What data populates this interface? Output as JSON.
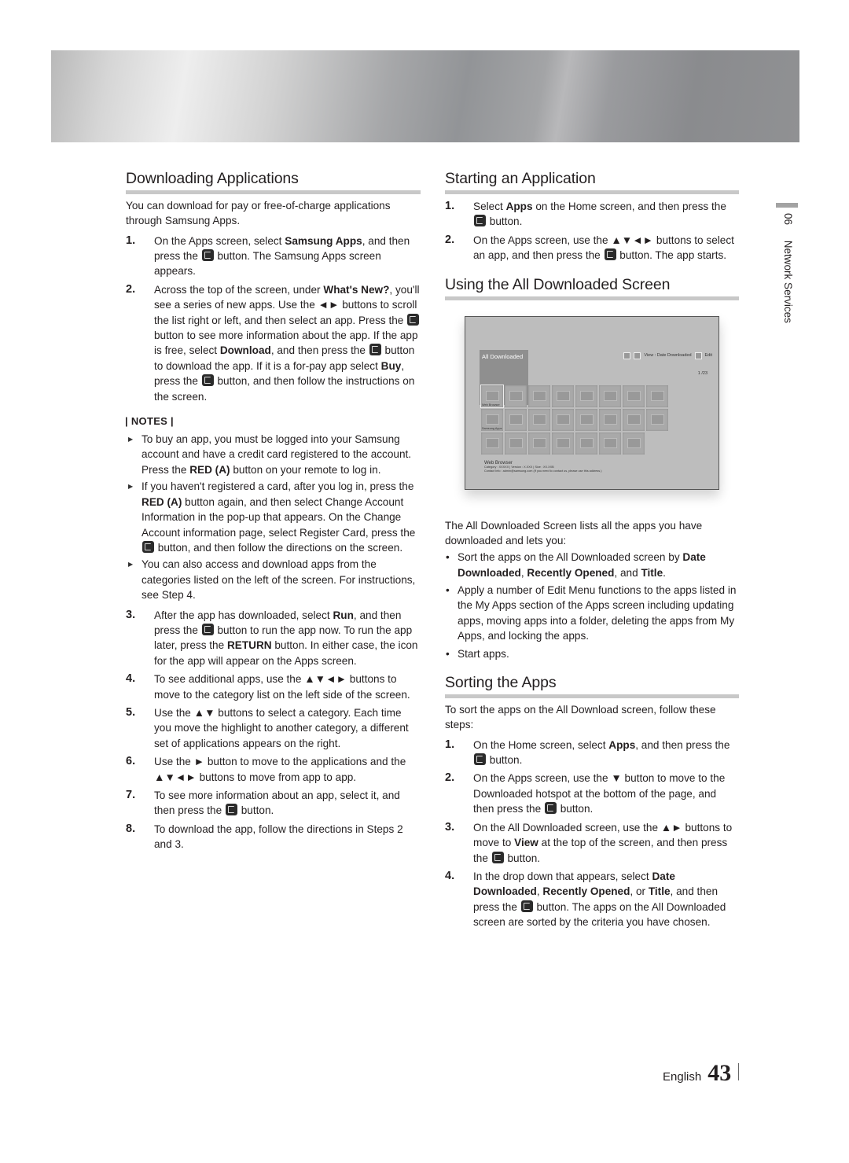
{
  "side_tab": {
    "chapter": "06",
    "title": "Network Services"
  },
  "left": {
    "heading": "Downloading Applications",
    "intro": "You can download for pay or free-of-charge applications through Samsung Apps.",
    "steps": [
      {
        "num": "1.",
        "parts": [
          "On the Apps screen, select ",
          "Samsung Apps",
          ", and then press the ",
          "ENTER",
          " button. The Samsung Apps screen appears."
        ]
      },
      {
        "num": "2.",
        "parts": [
          "Across the top of the screen, under ",
          "What's New?",
          ", you'll see a series of new apps. Use the ◄► buttons to scroll the list right or left, and then select an app. Press the ",
          "ENTER",
          " button to see more information about the app. If the app is free, select ",
          "Download",
          ", and then press the ",
          "ENTER",
          " button to download the app. If it is a for-pay app select ",
          "Buy",
          ", press the ",
          "ENTER",
          " button, and then follow the instructions on the screen."
        ]
      }
    ],
    "notes_label": "| NOTES |",
    "notes": [
      {
        "parts": [
          "To buy an app, you must be logged into your Samsung account and have a credit card registered to the account. Press the ",
          "RED (A)",
          " button on your remote to log in."
        ]
      },
      {
        "parts": [
          "If you haven't registered a card, after you log in, press the ",
          "RED (A)",
          " button again, and then select Change Account Information in the pop-up that appears. On the Change Account information page, select Register Card, press the ",
          "ENTER",
          " button, and then follow the directions on the screen."
        ]
      },
      {
        "parts": [
          "You can also access and download apps from the categories listed on the left of the screen. For instructions, see Step 4."
        ]
      }
    ],
    "steps2": [
      {
        "num": "3.",
        "parts": [
          "After the app has downloaded, select ",
          "Run",
          ", and then press the ",
          "ENTER",
          " button to run the app now. To run the app later, press the ",
          "RETURN",
          " button. In either case, the icon for the app will appear on the Apps screen."
        ]
      },
      {
        "num": "4.",
        "parts": [
          "To see additional apps, use the ▲▼◄► buttons to move to the category list on the left side of the screen."
        ]
      },
      {
        "num": "5.",
        "parts": [
          "Use the ▲▼ buttons to select a category. Each time you move the highlight to another category, a different set of applications appears on the right."
        ]
      },
      {
        "num": "6.",
        "parts": [
          "Use the ► button to move to the applications and the ▲▼◄► buttons to move from app to app."
        ]
      },
      {
        "num": "7.",
        "parts": [
          "To see more information about an app, select it, and then press the ",
          "ENTER",
          " button."
        ]
      },
      {
        "num": "8.",
        "parts": [
          "To download the app, follow the directions in Steps 2 and 3."
        ]
      }
    ]
  },
  "right": {
    "starting": {
      "heading": "Starting an Application",
      "steps": [
        {
          "num": "1.",
          "parts": [
            "Select ",
            "Apps",
            " on the Home screen, and then press the ",
            "ENTER",
            " button."
          ]
        },
        {
          "num": "2.",
          "parts": [
            "On the Apps screen, use the ▲▼◄► buttons to select an app, and then press the ",
            "ENTER",
            " button. The app starts."
          ]
        }
      ]
    },
    "using": {
      "heading": "Using the All Downloaded Screen",
      "screen": {
        "title": "All Downloaded",
        "view_label": "View : Date Downloaded",
        "edit_label": "Edit",
        "pager": "1 /23",
        "tile_labels": {
          "0": "Web Browser",
          "8": "Samsung Apps"
        },
        "tile_count": 23,
        "info_title": "Web Browser",
        "info_line1": "Category : XXXXX  |  Version : X.XXX  |  Size : XX.XXB",
        "info_line2": "Contact Info : admin@samsung.com (If you need to contact us, please use this address.)"
      },
      "intro": "The All Downloaded Screen lists all the apps you have downloaded and lets you:",
      "bullets": [
        {
          "parts": [
            "Sort the apps on the All Downloaded screen by ",
            "Date Downloaded",
            ", ",
            "Recently Opened",
            ", and ",
            "Title",
            "."
          ]
        },
        {
          "parts": [
            "Apply a number of Edit Menu functions to the apps listed in the My Apps section of the Apps screen including updating apps, moving apps into a folder, deleting the apps from My Apps, and locking the apps."
          ]
        },
        {
          "parts": [
            "Start apps."
          ]
        }
      ]
    },
    "sorting": {
      "heading": "Sorting the Apps",
      "intro": "To sort the apps on the All Download screen, follow these steps:",
      "steps": [
        {
          "num": "1.",
          "parts": [
            "On the Home screen, select ",
            "Apps",
            ", and then press the ",
            "ENTER",
            " button."
          ]
        },
        {
          "num": "2.",
          "parts": [
            "On the Apps screen, use the ▼ button to move to the Downloaded hotspot at the bottom of the page, and then press the ",
            "ENTER",
            " button."
          ]
        },
        {
          "num": "3.",
          "parts": [
            "On the All Downloaded screen, use the ▲► buttons to move to ",
            "View",
            " at the top of the screen, and then press the ",
            "ENTER",
            " button."
          ]
        },
        {
          "num": "4.",
          "parts": [
            "In the drop down that appears, select ",
            "Date Downloaded",
            ", ",
            "Recently Opened",
            ", or ",
            "Title",
            ", and then press the ",
            "ENTER",
            " button. The apps on the All Downloaded screen are sorted by the criteria you have chosen."
          ]
        }
      ]
    }
  },
  "footer": {
    "language": "English",
    "page_number": "43"
  }
}
